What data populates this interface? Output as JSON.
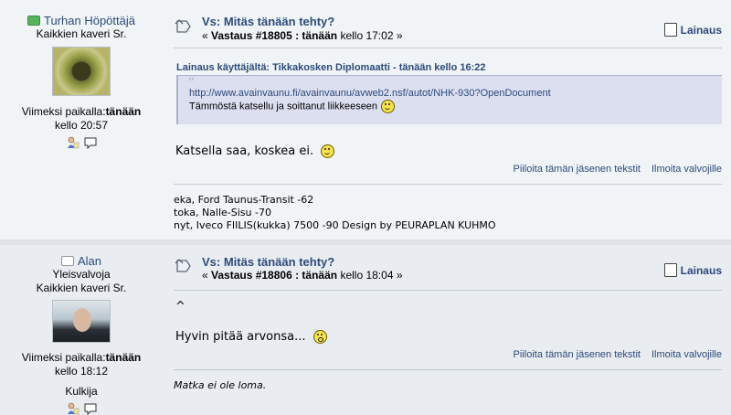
{
  "posts": [
    {
      "poster_name": "Turhan Höpöttäjä",
      "rank": "Kaikkien kaveri Sr.",
      "online": true,
      "last_seen_label": "Viimeksi paikalla:",
      "last_seen_day": "tänään",
      "last_seen_time": "kello 20:57",
      "subject": "Vs: Mitäs tänään tehty?",
      "reply_prefix": "« ",
      "reply_no": "Vastaus #18805 : tänään",
      "reply_time": " kello 17:02 »",
      "quote_button": "Lainaus",
      "quote": {
        "header": "Lainaus käyttäjältä: Tikkakosken Diplomaatti - tänään kello 16:22",
        "link": "http://www.avainvaunu.fi/avainvaunu/avweb2.nsf/autot/NHK-930?OpenDocument",
        "text": "Tämmöstä katsellu ja soittanut liikkeeseen"
      },
      "body": "Katsella saa, koskea ei.",
      "hide_text": "Piiloita tämän jäsenen tekstit",
      "report_text": "Ilmoita valvojille",
      "signature": [
        "eka, Ford Taunus-Transit -62",
        "toka, Nalle-Sisu -70",
        "nyt, Iveco FIILIS(kukka) 7500 -90 Design by PEURAPLAN KUHMO"
      ]
    },
    {
      "poster_name": "Alan",
      "role": "Yleisvalvoja",
      "rank": "Kaikkien kaveri Sr.",
      "online": false,
      "last_seen_label": "Viimeksi paikalla:",
      "last_seen_day": "tänään",
      "last_seen_time": "kello 18:12",
      "location": "Kulkija",
      "subject": "Vs: Mitäs tänään tehty?",
      "reply_prefix": "« ",
      "reply_no": "Vastaus #18806 : tänään",
      "reply_time": " kello 18:04 »",
      "quote_button": "Lainaus",
      "body_line1": "^",
      "body": "Hyvin pitää arvonsa...",
      "hide_text": "Piiloita tämän jäsenen tekstit",
      "report_text": "Ilmoita valvojille",
      "signature_italic": "Matka ei ole loma."
    }
  ]
}
